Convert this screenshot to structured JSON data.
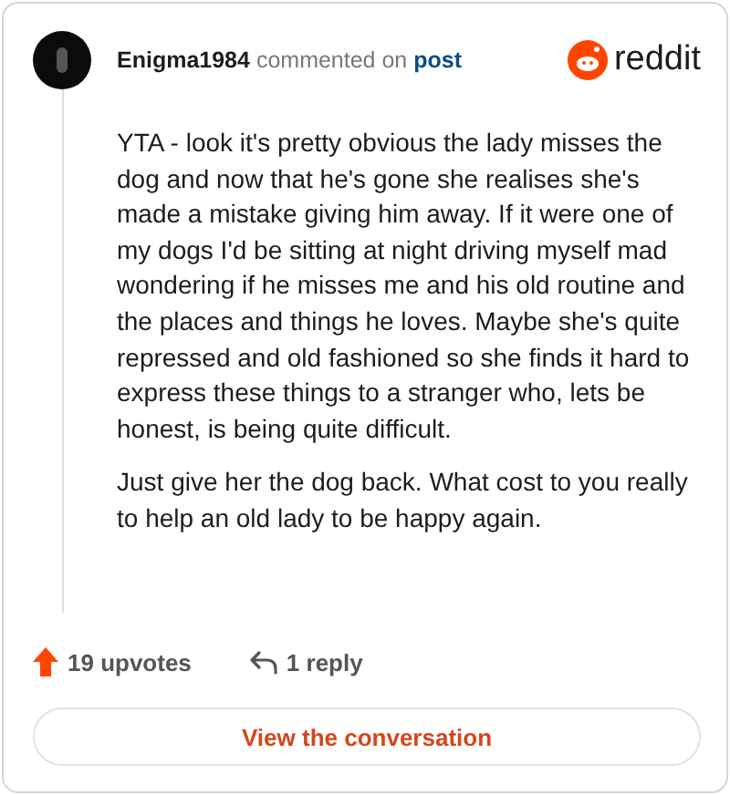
{
  "header": {
    "username": "Enigma1984",
    "action": "commented on",
    "link": "post",
    "brand": "reddit"
  },
  "paragraphs": [
    "YTA - look it's pretty obvious the lady misses the dog and now that he's gone she realises she's made a mistake giving him away. If it were one of my dogs I'd be sitting at night driving myself mad wondering if he misses me and his old routine and the places and things he loves. Maybe she's quite repressed and old fashioned so she finds it hard to express these things to a stranger who, lets be honest, is being quite difficult.",
    "Just give her the dog back. What cost to you really to help an old lady to be happy again."
  ],
  "footer": {
    "upvotes": "19 upvotes",
    "replies": "1 reply"
  },
  "button": "View the conversation"
}
